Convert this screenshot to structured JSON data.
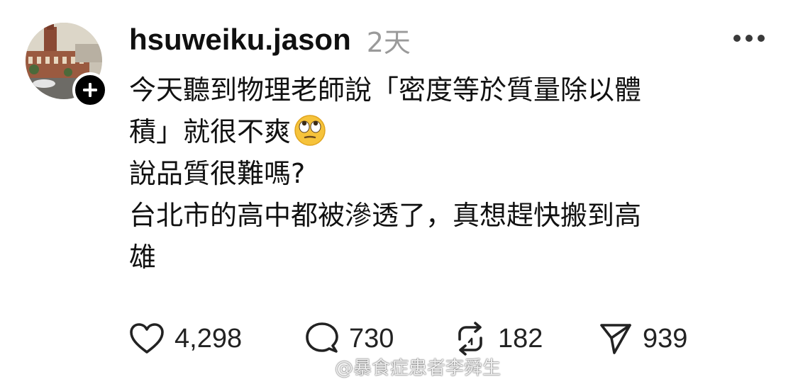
{
  "post": {
    "username": "hsuweiku.jason",
    "timestamp": "2天",
    "lines": [
      "今天聽到物理老師說「密度等於質量除以體",
      "積」就很不爽",
      "說品質很難嗎?",
      "台北市的高中都被滲透了，真想趕快搬到高",
      "雄"
    ],
    "emoji": "eye-roll-emoji"
  },
  "actions": {
    "like_count": "4,298",
    "comment_count": "730",
    "repost_count": "182",
    "share_count": "939"
  },
  "watermark": {
    "text": "@暴食症患者李舜生"
  },
  "icons": {
    "avatar": "building-photo",
    "follow": "plus-icon",
    "more": "more-icon",
    "like": "heart-icon",
    "comment": "comment-icon",
    "repost": "repost-icon",
    "share": "send-icon",
    "watermark_logo": "weibo-logo-icon"
  },
  "colors": {
    "text": "#111111",
    "muted": "#9a9a9a",
    "badge": "#000000",
    "background": "#ffffff"
  }
}
